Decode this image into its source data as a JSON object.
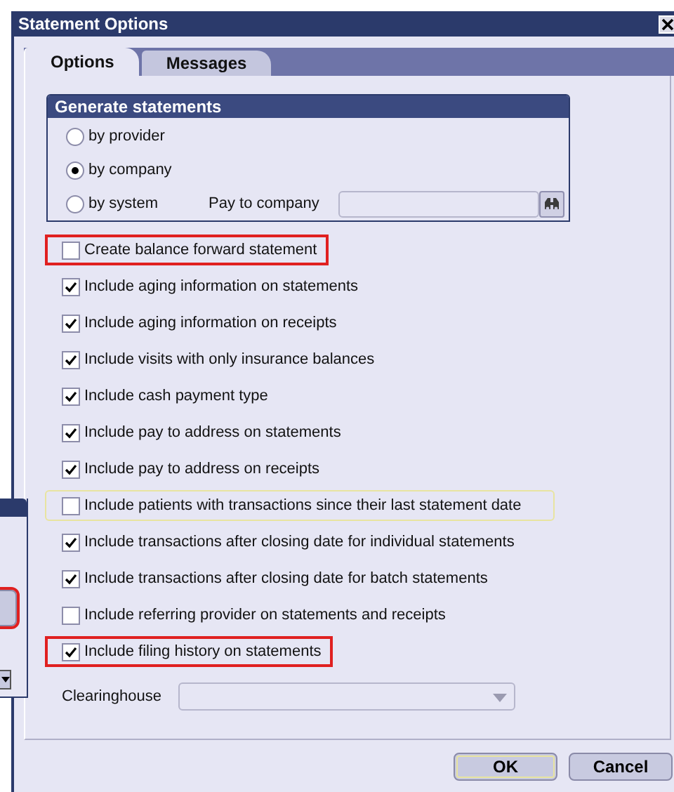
{
  "window": {
    "title": "Statement Options"
  },
  "tabs": [
    {
      "label": "Options",
      "selected": true
    },
    {
      "label": "Messages",
      "selected": false
    }
  ],
  "generate_statements": {
    "title": "Generate statements",
    "options": [
      {
        "label": "by provider",
        "selected": false
      },
      {
        "label": "by company",
        "selected": true
      },
      {
        "label": "by system",
        "selected": false
      }
    ],
    "pay_to_company": {
      "label": "Pay to company"
    }
  },
  "checkboxes": [
    {
      "label": "Create balance forward statement",
      "checked": false,
      "highlighted": true,
      "focused": false
    },
    {
      "label": "Include aging information on statements",
      "checked": true,
      "highlighted": false,
      "focused": false
    },
    {
      "label": "Include aging information on receipts",
      "checked": true,
      "highlighted": false,
      "focused": false
    },
    {
      "label": "Include visits with only insurance balances",
      "checked": true,
      "highlighted": false,
      "focused": false
    },
    {
      "label": "Include cash payment type",
      "checked": true,
      "highlighted": false,
      "focused": false
    },
    {
      "label": "Include pay to address on statements",
      "checked": true,
      "highlighted": false,
      "focused": false
    },
    {
      "label": "Include pay to address on receipts",
      "checked": true,
      "highlighted": false,
      "focused": false
    },
    {
      "label": "Include patients with transactions since their last statement date",
      "checked": false,
      "highlighted": false,
      "focused": true
    },
    {
      "label": "Include transactions after closing date for individual statements",
      "checked": true,
      "highlighted": false,
      "focused": false
    },
    {
      "label": "Include transactions after closing date for batch statements",
      "checked": true,
      "highlighted": false,
      "focused": false
    },
    {
      "label": "Include referring provider on statements and receipts",
      "checked": false,
      "highlighted": false,
      "focused": false
    },
    {
      "label": "Include filing history on statements",
      "checked": true,
      "highlighted": true,
      "focused": false
    }
  ],
  "clearinghouse": {
    "label": "Clearinghouse"
  },
  "buttons": [
    {
      "label": "OK",
      "focused": true
    },
    {
      "label": "Cancel",
      "focused": false
    }
  ],
  "side_window": {
    "button_highlighted": true
  }
}
